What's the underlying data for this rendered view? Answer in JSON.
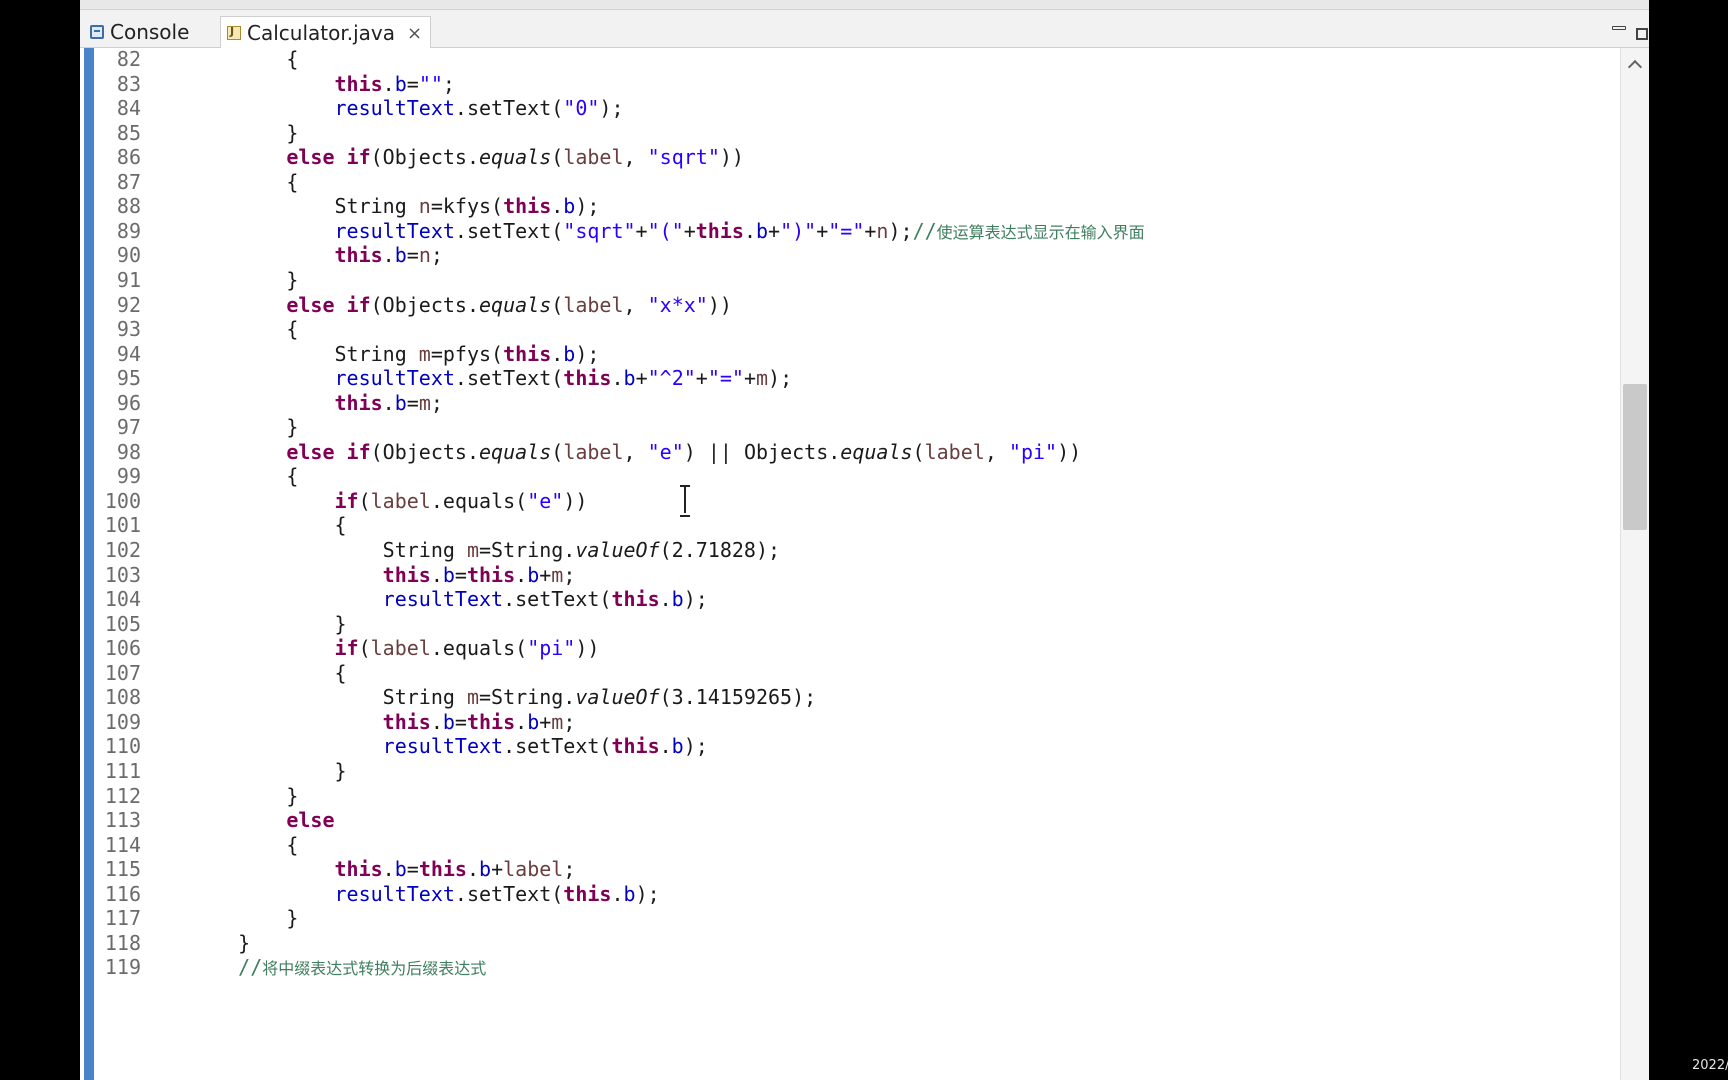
{
  "tabs": {
    "console_label": "Console",
    "editor_label": "Calculator.java",
    "close_glyph": "×"
  },
  "taskbar": {
    "clock_text": "2022/"
  },
  "colors": {
    "keyword": "#7f0055",
    "string": "#2a00ff",
    "field": "#0000c0",
    "comment": "#3f7f5f",
    "line_number": "#6b6b6b",
    "change_ruler": "#4a84c9"
  },
  "code": {
    "lines": [
      {
        "no": "82",
        "tokens": [
          {
            "t": "        {"
          }
        ]
      },
      {
        "no": "83",
        "tokens": [
          {
            "t": "            "
          },
          {
            "t": "this",
            "c": "kw"
          },
          {
            "t": "."
          },
          {
            "t": "b",
            "c": "fld"
          },
          {
            "t": "="
          },
          {
            "t": "\"\"",
            "c": "str"
          },
          {
            "t": ";"
          }
        ]
      },
      {
        "no": "84",
        "tokens": [
          {
            "t": "            "
          },
          {
            "t": "resultText",
            "c": "fld"
          },
          {
            "t": ".setText("
          },
          {
            "t": "\"0\"",
            "c": "str"
          },
          {
            "t": ");"
          }
        ]
      },
      {
        "no": "85",
        "tokens": [
          {
            "t": "        }"
          }
        ]
      },
      {
        "no": "86",
        "tokens": [
          {
            "t": "        "
          },
          {
            "t": "else",
            "c": "kw"
          },
          {
            "t": " "
          },
          {
            "t": "if",
            "c": "kw"
          },
          {
            "t": "(Objects."
          },
          {
            "t": "equals",
            "c": "it"
          },
          {
            "t": "("
          },
          {
            "t": "label",
            "c": "var"
          },
          {
            "t": ", "
          },
          {
            "t": "\"sqrt\"",
            "c": "str"
          },
          {
            "t": "))"
          }
        ]
      },
      {
        "no": "87",
        "tokens": [
          {
            "t": "        {"
          }
        ]
      },
      {
        "no": "88",
        "tokens": [
          {
            "t": "            String "
          },
          {
            "t": "n",
            "c": "var"
          },
          {
            "t": "=kfys("
          },
          {
            "t": "this",
            "c": "kw"
          },
          {
            "t": "."
          },
          {
            "t": "b",
            "c": "fld"
          },
          {
            "t": ");"
          }
        ]
      },
      {
        "no": "89",
        "tokens": [
          {
            "t": "            "
          },
          {
            "t": "resultText",
            "c": "fld"
          },
          {
            "t": ".setText("
          },
          {
            "t": "\"sqrt\"",
            "c": "str"
          },
          {
            "t": "+"
          },
          {
            "t": "\"(\"",
            "c": "str"
          },
          {
            "t": "+"
          },
          {
            "t": "this",
            "c": "kw"
          },
          {
            "t": "."
          },
          {
            "t": "b",
            "c": "fld"
          },
          {
            "t": "+"
          },
          {
            "t": "\")\"",
            "c": "str"
          },
          {
            "t": "+"
          },
          {
            "t": "\"=\"",
            "c": "str"
          },
          {
            "t": "+"
          },
          {
            "t": "n",
            "c": "var"
          },
          {
            "t": ");"
          },
          {
            "t": "//",
            "c": "cm"
          },
          {
            "t": "使运算表达式显示在输入界面",
            "c": "cm-zh"
          }
        ]
      },
      {
        "no": "90",
        "tokens": [
          {
            "t": "            "
          },
          {
            "t": "this",
            "c": "kw"
          },
          {
            "t": "."
          },
          {
            "t": "b",
            "c": "fld"
          },
          {
            "t": "="
          },
          {
            "t": "n",
            "c": "var"
          },
          {
            "t": ";"
          }
        ]
      },
      {
        "no": "91",
        "tokens": [
          {
            "t": "        }"
          }
        ]
      },
      {
        "no": "92",
        "tokens": [
          {
            "t": "        "
          },
          {
            "t": "else",
            "c": "kw"
          },
          {
            "t": " "
          },
          {
            "t": "if",
            "c": "kw"
          },
          {
            "t": "(Objects."
          },
          {
            "t": "equals",
            "c": "it"
          },
          {
            "t": "("
          },
          {
            "t": "label",
            "c": "var"
          },
          {
            "t": ", "
          },
          {
            "t": "\"x*x\"",
            "c": "str"
          },
          {
            "t": "))"
          }
        ]
      },
      {
        "no": "93",
        "tokens": [
          {
            "t": "        {"
          }
        ]
      },
      {
        "no": "94",
        "tokens": [
          {
            "t": "            String "
          },
          {
            "t": "m",
            "c": "var"
          },
          {
            "t": "=pfys("
          },
          {
            "t": "this",
            "c": "kw"
          },
          {
            "t": "."
          },
          {
            "t": "b",
            "c": "fld"
          },
          {
            "t": ");"
          }
        ]
      },
      {
        "no": "95",
        "tokens": [
          {
            "t": "            "
          },
          {
            "t": "resultText",
            "c": "fld"
          },
          {
            "t": ".setText("
          },
          {
            "t": "this",
            "c": "kw"
          },
          {
            "t": "."
          },
          {
            "t": "b",
            "c": "fld"
          },
          {
            "t": "+"
          },
          {
            "t": "\"^2\"",
            "c": "str"
          },
          {
            "t": "+"
          },
          {
            "t": "\"=\"",
            "c": "str"
          },
          {
            "t": "+"
          },
          {
            "t": "m",
            "c": "var"
          },
          {
            "t": ");"
          }
        ]
      },
      {
        "no": "96",
        "tokens": [
          {
            "t": "            "
          },
          {
            "t": "this",
            "c": "kw"
          },
          {
            "t": "."
          },
          {
            "t": "b",
            "c": "fld"
          },
          {
            "t": "="
          },
          {
            "t": "m",
            "c": "var"
          },
          {
            "t": ";"
          }
        ]
      },
      {
        "no": "97",
        "tokens": [
          {
            "t": "        }"
          }
        ]
      },
      {
        "no": "98",
        "tokens": [
          {
            "t": "        "
          },
          {
            "t": "else",
            "c": "kw"
          },
          {
            "t": " "
          },
          {
            "t": "if",
            "c": "kw"
          },
          {
            "t": "(Objects."
          },
          {
            "t": "equals",
            "c": "it"
          },
          {
            "t": "("
          },
          {
            "t": "label",
            "c": "var"
          },
          {
            "t": ", "
          },
          {
            "t": "\"e\"",
            "c": "str"
          },
          {
            "t": ") || Objects."
          },
          {
            "t": "equals",
            "c": "it"
          },
          {
            "t": "("
          },
          {
            "t": "label",
            "c": "var"
          },
          {
            "t": ", "
          },
          {
            "t": "\"pi\"",
            "c": "str"
          },
          {
            "t": "))"
          }
        ]
      },
      {
        "no": "99",
        "tokens": [
          {
            "t": "        {"
          }
        ]
      },
      {
        "no": "100",
        "tokens": [
          {
            "t": "            "
          },
          {
            "t": "if",
            "c": "kw"
          },
          {
            "t": "("
          },
          {
            "t": "label",
            "c": "var"
          },
          {
            "t": ".equals("
          },
          {
            "t": "\"e\"",
            "c": "str"
          },
          {
            "t": "))"
          }
        ]
      },
      {
        "no": "101",
        "tokens": [
          {
            "t": "            {"
          }
        ]
      },
      {
        "no": "102",
        "tokens": [
          {
            "t": "                String "
          },
          {
            "t": "m",
            "c": "var"
          },
          {
            "t": "=String."
          },
          {
            "t": "valueOf",
            "c": "it"
          },
          {
            "t": "(2.71828);"
          }
        ]
      },
      {
        "no": "103",
        "tokens": [
          {
            "t": "                "
          },
          {
            "t": "this",
            "c": "kw"
          },
          {
            "t": "."
          },
          {
            "t": "b",
            "c": "fld"
          },
          {
            "t": "="
          },
          {
            "t": "this",
            "c": "kw"
          },
          {
            "t": "."
          },
          {
            "t": "b",
            "c": "fld"
          },
          {
            "t": "+"
          },
          {
            "t": "m",
            "c": "var"
          },
          {
            "t": ";"
          }
        ]
      },
      {
        "no": "104",
        "tokens": [
          {
            "t": "                "
          },
          {
            "t": "resultText",
            "c": "fld"
          },
          {
            "t": ".setText("
          },
          {
            "t": "this",
            "c": "kw"
          },
          {
            "t": "."
          },
          {
            "t": "b",
            "c": "fld"
          },
          {
            "t": ");"
          }
        ]
      },
      {
        "no": "105",
        "tokens": [
          {
            "t": "            }"
          }
        ]
      },
      {
        "no": "106",
        "tokens": [
          {
            "t": "            "
          },
          {
            "t": "if",
            "c": "kw"
          },
          {
            "t": "("
          },
          {
            "t": "label",
            "c": "var"
          },
          {
            "t": ".equals("
          },
          {
            "t": "\"pi\"",
            "c": "str"
          },
          {
            "t": "))"
          }
        ]
      },
      {
        "no": "107",
        "tokens": [
          {
            "t": "            {"
          }
        ]
      },
      {
        "no": "108",
        "tokens": [
          {
            "t": "                String "
          },
          {
            "t": "m",
            "c": "var"
          },
          {
            "t": "=String."
          },
          {
            "t": "valueOf",
            "c": "it"
          },
          {
            "t": "(3.14159265);"
          }
        ]
      },
      {
        "no": "109",
        "tokens": [
          {
            "t": "                "
          },
          {
            "t": "this",
            "c": "kw"
          },
          {
            "t": "."
          },
          {
            "t": "b",
            "c": "fld"
          },
          {
            "t": "="
          },
          {
            "t": "this",
            "c": "kw"
          },
          {
            "t": "."
          },
          {
            "t": "b",
            "c": "fld"
          },
          {
            "t": "+"
          },
          {
            "t": "m",
            "c": "var"
          },
          {
            "t": ";"
          }
        ]
      },
      {
        "no": "110",
        "tokens": [
          {
            "t": "                "
          },
          {
            "t": "resultText",
            "c": "fld"
          },
          {
            "t": ".setText("
          },
          {
            "t": "this",
            "c": "kw"
          },
          {
            "t": "."
          },
          {
            "t": "b",
            "c": "fld"
          },
          {
            "t": ");"
          }
        ]
      },
      {
        "no": "111",
        "tokens": [
          {
            "t": "            }"
          }
        ]
      },
      {
        "no": "112",
        "tokens": [
          {
            "t": "        }"
          }
        ]
      },
      {
        "no": "113",
        "tokens": [
          {
            "t": "        "
          },
          {
            "t": "else",
            "c": "kw"
          }
        ]
      },
      {
        "no": "114",
        "tokens": [
          {
            "t": "        {"
          }
        ]
      },
      {
        "no": "115",
        "tokens": [
          {
            "t": "            "
          },
          {
            "t": "this",
            "c": "kw"
          },
          {
            "t": "."
          },
          {
            "t": "b",
            "c": "fld"
          },
          {
            "t": "="
          },
          {
            "t": "this",
            "c": "kw"
          },
          {
            "t": "."
          },
          {
            "t": "b",
            "c": "fld"
          },
          {
            "t": "+"
          },
          {
            "t": "label",
            "c": "var"
          },
          {
            "t": ";"
          }
        ]
      },
      {
        "no": "116",
        "tokens": [
          {
            "t": "            "
          },
          {
            "t": "resultText",
            "c": "fld"
          },
          {
            "t": ".setText("
          },
          {
            "t": "this",
            "c": "kw"
          },
          {
            "t": "."
          },
          {
            "t": "b",
            "c": "fld"
          },
          {
            "t": ");"
          }
        ]
      },
      {
        "no": "117",
        "tokens": [
          {
            "t": "        }"
          }
        ]
      },
      {
        "no": "118",
        "tokens": [
          {
            "t": "    }"
          }
        ]
      },
      {
        "no": "119",
        "tokens": [
          {
            "t": "    "
          },
          {
            "t": "//",
            "c": "cm"
          },
          {
            "t": "将中缀表达式转换为后缀表达式",
            "c": "cm-zh"
          }
        ]
      }
    ]
  }
}
